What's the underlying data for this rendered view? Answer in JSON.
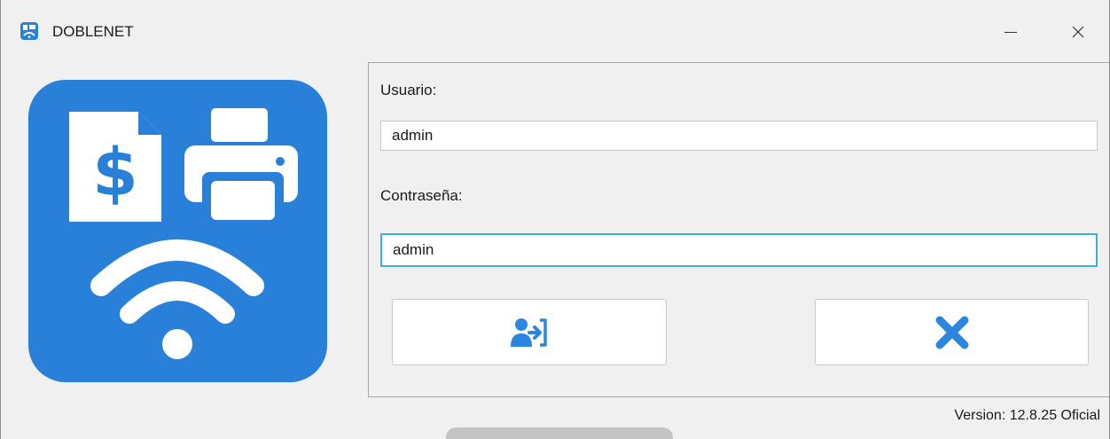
{
  "window": {
    "title": "DOBLENET",
    "icons": {
      "app": "app-logo-icon",
      "minimize": "minimize-icon",
      "close": "close-icon"
    }
  },
  "logo": {
    "icon": "billing-printer-wifi-logo",
    "color": "#2880d9"
  },
  "form": {
    "user_label": "Usuario:",
    "user_value": "admin",
    "password_label": "Contraseña:",
    "password_value": "admin",
    "login_button_icon": "user-login-icon",
    "cancel_button_icon": "cancel-x-icon",
    "accent_color": "#2b86e0",
    "focus_color": "#3bb0d8"
  },
  "footer": {
    "version": "Version: 12.8.25 Oficial"
  }
}
